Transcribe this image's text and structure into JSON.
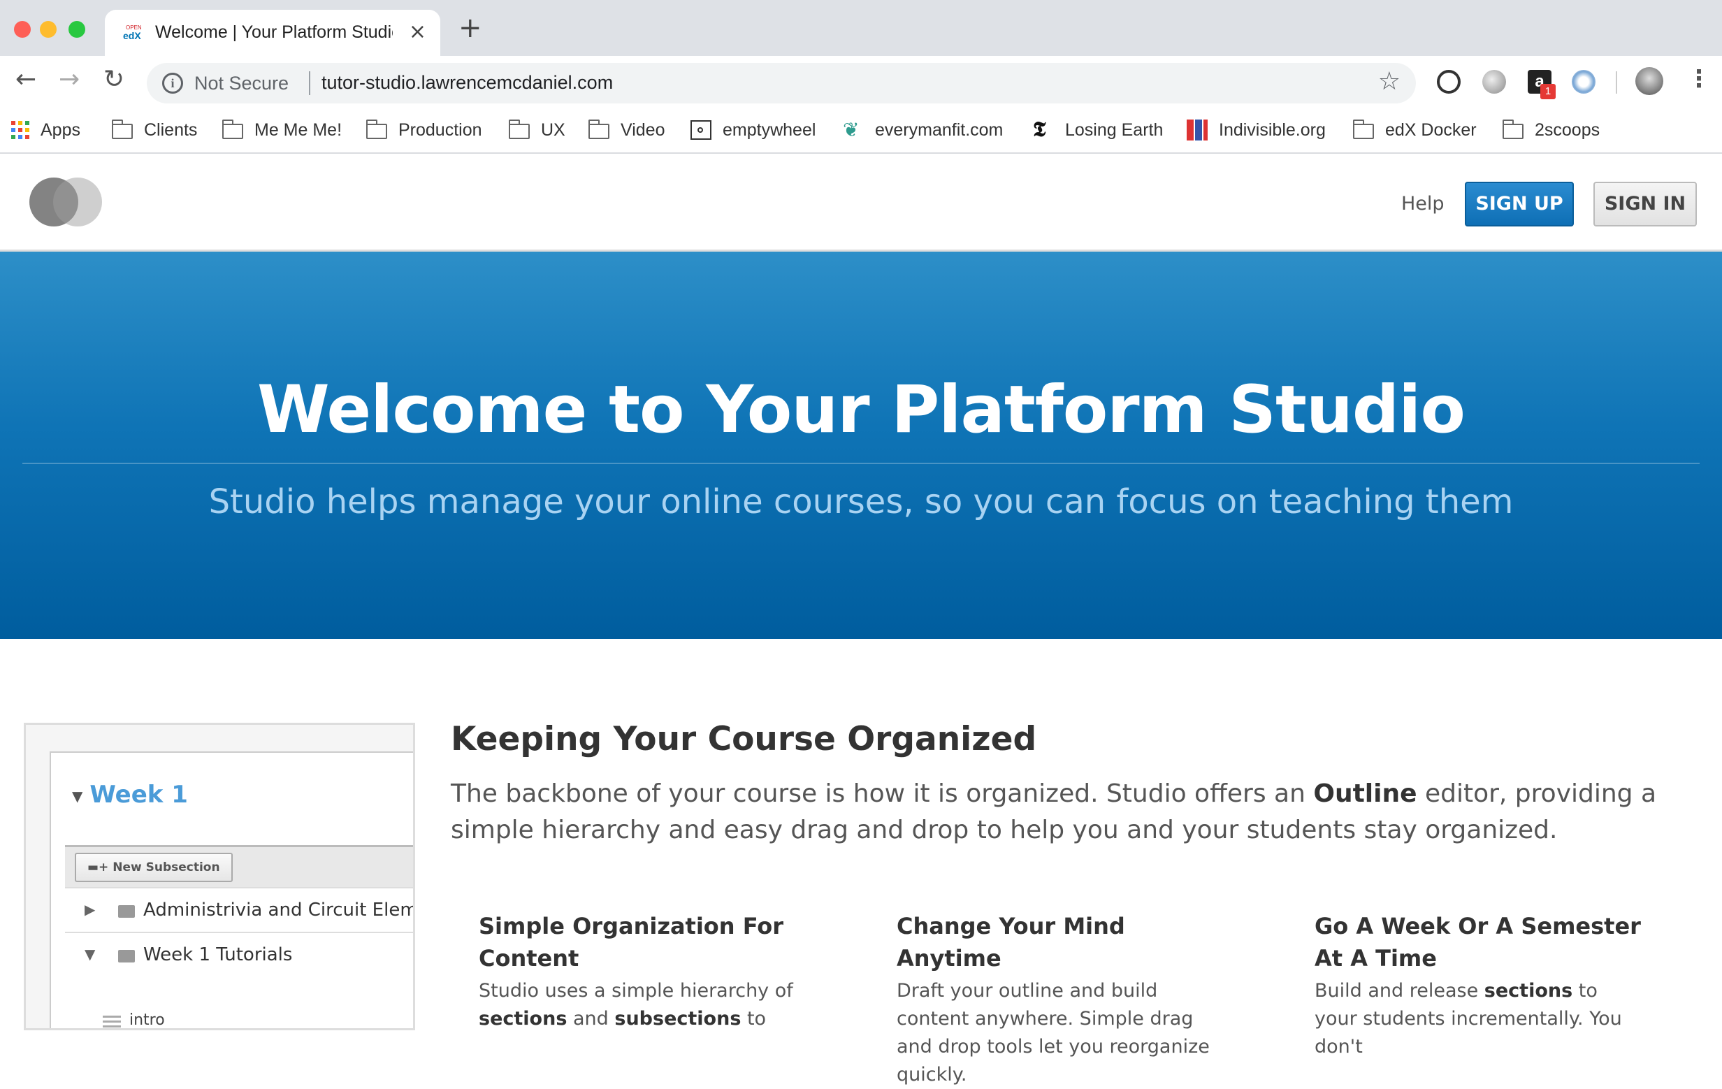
{
  "browser": {
    "tab": {
      "title": "Welcome | Your Platform Studio",
      "favicon_text_top": "OPEN",
      "favicon_text_bottom": "edX",
      "close_glyph": "×",
      "new_tab_glyph": "+"
    },
    "nav": {
      "back_glyph": "←",
      "forward_glyph": "→",
      "reload_glyph": "↻"
    },
    "omnibox": {
      "info_glyph": "i",
      "security_label": "Not Secure",
      "url": "tutor-studio.lawrencemcdaniel.com",
      "star_glyph": "☆"
    },
    "extensions": {
      "amazon_letter": "a",
      "amazon_badge": "1"
    },
    "menu_glyph": "⋮",
    "bookmarks": [
      {
        "label": "Apps",
        "icon": "apps-grid-icon"
      },
      {
        "label": "Clients",
        "icon": "folder-icon"
      },
      {
        "label": "Me Me Me!",
        "icon": "folder-icon"
      },
      {
        "label": "Production",
        "icon": "folder-icon"
      },
      {
        "label": "UX",
        "icon": "folder-icon"
      },
      {
        "label": "Video",
        "icon": "folder-icon"
      },
      {
        "label": "emptywheel",
        "icon": "emptywheel-icon"
      },
      {
        "label": "everymanfit.com",
        "icon": "everymanfit-icon"
      },
      {
        "label": "Losing Earth",
        "icon": "nyt-icon"
      },
      {
        "label": "Indivisible.org",
        "icon": "indivisible-icon"
      },
      {
        "label": "edX Docker",
        "icon": "folder-icon"
      },
      {
        "label": "2scoops",
        "icon": "folder-icon"
      }
    ]
  },
  "header": {
    "help": "Help",
    "sign_up": "SIGN UP",
    "sign_in": "SIGN IN"
  },
  "hero": {
    "title": "Welcome to Your Platform Studio",
    "subtitle": "Studio helps manage your online courses, so you can focus on teaching them"
  },
  "feature": {
    "screenshot": {
      "week": "Week 1",
      "new_subsection": "New Subsection",
      "rows": [
        "Administrivia and Circuit Elements",
        "Week 1 Tutorials"
      ],
      "intro": "intro"
    },
    "title": "Keeping Your Course Organized",
    "desc_part1": "The backbone of your course is how it is organized. Studio offers an ",
    "desc_bold": "Outline",
    "desc_part2": " editor, providing a simple hierarchy and easy drag and drop to help you and your students stay organized.",
    "columns": [
      {
        "title": "Simple Organization For Content",
        "p1": "Studio uses a simple hierarchy of ",
        "b1": "sections",
        "p2": " and ",
        "b2": "subsections",
        "p3": " to"
      },
      {
        "title": "Change Your Mind Anytime",
        "text": "Draft your outline and build content anywhere. Simple drag and drop tools let you reorganize quickly."
      },
      {
        "title": "Go A Week Or A Semester At A Time",
        "p1": "Build and release ",
        "b1": "sections",
        "p2": " to your students incrementally. You don't"
      }
    ]
  },
  "colors": {
    "hero_top": "#2d8fc8",
    "hero_bottom": "#005d9e",
    "signup_blue": "#1a7fc4",
    "link_blue": "#4a9bd8"
  }
}
